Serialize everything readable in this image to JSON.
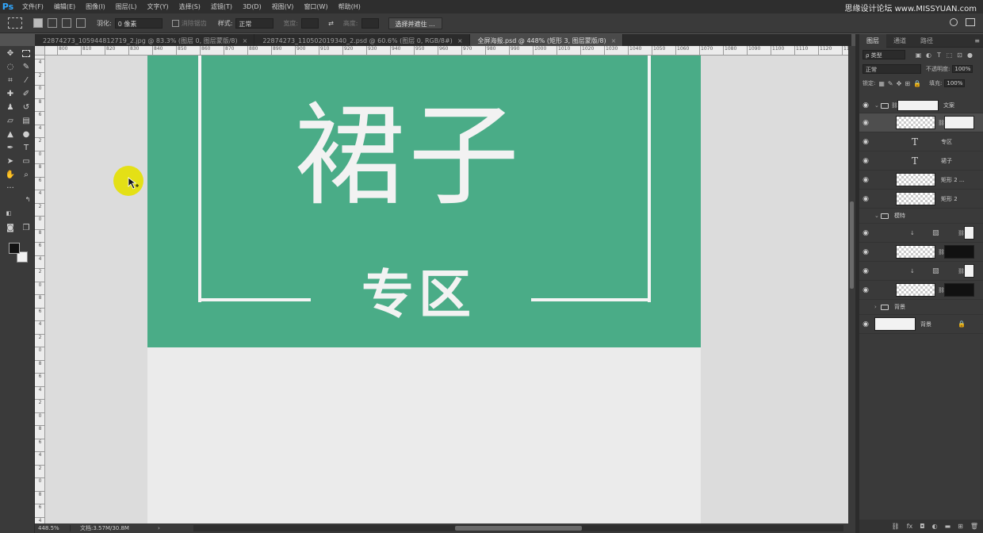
{
  "app": {
    "logo": "Ps",
    "watermark": "思缘设计论坛 www.MISSYUAN.com"
  },
  "menu": [
    "文件(F)",
    "编辑(E)",
    "图像(I)",
    "图层(L)",
    "文字(Y)",
    "选择(S)",
    "滤镜(T)",
    "3D(D)",
    "视图(V)",
    "窗口(W)",
    "帮助(H)"
  ],
  "options": {
    "feather_label": "羽化:",
    "feather_value": "0 像素",
    "antialias_label": "消除锯齿",
    "style_label": "样式:",
    "style_value": "正常",
    "width_label": "宽度:",
    "height_label": "高度:",
    "select_mask_button": "选择并遮住 ..."
  },
  "tabs": [
    {
      "label": "22874273_105944812719_2.jpg @ 83.3% (图层 0, 图层蒙版/8)",
      "close": "×"
    },
    {
      "label": "22874273_110502019340_2.psd @ 60.6% (图层 0, RGB/8#)",
      "close": "×"
    },
    {
      "label": "全屏海报.psd @ 448% (矩形 3, 图层蒙版/8)",
      "close": "×"
    }
  ],
  "ruler": {
    "h": [
      "800",
      "810",
      "820",
      "830",
      "840",
      "850",
      "860",
      "870",
      "880",
      "890",
      "900",
      "910",
      "920",
      "930",
      "940",
      "950",
      "960",
      "970",
      "980",
      "990",
      "1000",
      "1010",
      "1020",
      "1030",
      "1040",
      "1050",
      "1060",
      "1070",
      "1080",
      "1090",
      "1100",
      "1110",
      "1120",
      "1130"
    ],
    "v": [
      "4",
      "2",
      "0",
      "8",
      "6",
      "4",
      "2",
      "0",
      "8",
      "6",
      "4",
      "2",
      "0",
      "8",
      "6",
      "4",
      "2",
      "0",
      "8",
      "6",
      "4",
      "2",
      "0",
      "8",
      "6",
      "4",
      "2",
      "0",
      "8",
      "6",
      "4",
      "2",
      "0",
      "8",
      "6",
      "4"
    ]
  },
  "artwork": {
    "title": "裙子",
    "subtitle": "专区"
  },
  "status": {
    "zoom": "448.5%",
    "doc": "文档:3.57M/30.8M"
  },
  "colors": {
    "banner": "#4aac87",
    "accent": "#31a8ff"
  },
  "layers_panel": {
    "tabs": [
      "图层",
      "通道",
      "路径"
    ],
    "filter_type": "ρ 类型",
    "blend_mode": "正常",
    "opacity_label": "不透明度:",
    "opacity_value": "100%",
    "lock_label": "锁定:",
    "fill_label": "填充:",
    "fill_value": "100%",
    "layers": {
      "group_text": "文案",
      "text_zone": "专区",
      "text_skirt": "裙子",
      "rect_copy": "矩形 2 ...",
      "rect2": "矩形 2",
      "group_model": "模特",
      "group_bg": "背景",
      "bg": "背景"
    }
  }
}
